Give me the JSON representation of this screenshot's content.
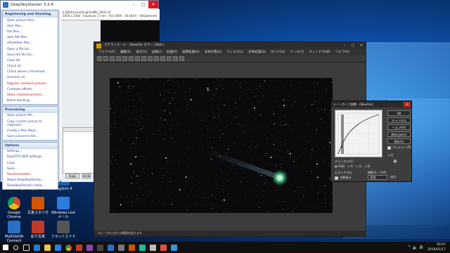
{
  "dss": {
    "title": "DeepSkyStacker 3.3.4",
    "infobar_line1": "E:\\DSS\\Comet\\Lights\\IMG_0001.tif",
    "infobar_line2": "3456 x 2304 - Exposure: 2 min - ISO 1600 - 16 bit/ch - (Registered)",
    "registering_panel": {
      "header": "Registering and Stacking",
      "items": [
        "Open picture files...",
        "dark files...",
        "flat files...",
        "dark flat files...",
        "offset/bias files...",
        "Open a file list...",
        "Save the file list...",
        "Clear list",
        "Check all",
        "Check above a threshold...",
        "Uncheck all",
        "Register checked pictures...",
        "Compute offsets...",
        "Stack checked pictures...",
        "Batch stacking..."
      ]
    },
    "processing_panel": {
      "header": "Processing",
      "items": [
        "Open picture file...",
        "Copy current picture to clipboard",
        "Create a Star Mask...",
        "Save picture to file..."
      ]
    },
    "options_panel": {
      "header": "Options",
      "items": [
        "Settings...",
        "Raw/FITS DDP Settings...",
        "Load...",
        "Save...",
        "Recommended...",
        "About DeepSkyStacker...",
        "DeepSkyStacker's Help..."
      ]
    },
    "apply_label": "Apply",
    "undo_label": "Undo"
  },
  "darkapp": {
    "title": "ステライメージ - [NewFile カラー 16bit]",
    "menu": [
      "ファイル(F)",
      "編集(E)",
      "表示(V)",
      "画像(I)",
      "処理(P)",
      "画像処理(A)",
      "天体写真(S)",
      "フィルタ(L)",
      "天体処理(D)",
      "ガイド(G)",
      "ツール(T)",
      "ウィンドウ(W)",
      "ヘルプ(H)"
    ],
    "status": "コピーされた全ての範囲を貼ります"
  },
  "tone": {
    "title": "トーンカーブ調整 - [NewFile]",
    "buttons": [
      "OK",
      "キャンセル",
      "ヘルプ(H)",
      "読み込み(L)",
      "保存(S)"
    ],
    "preview_label": "プレビュー(P)",
    "channel_label": "チャンネル(C)",
    "channels": [
      "RGB",
      "R",
      "G",
      "B"
    ],
    "histogram_label": "ヒストグラム",
    "log_label": "対数表示",
    "preset_label": "標準カーブ(P)",
    "preset_value": "直線",
    "input_label": "入力",
    "output_label": "出力"
  },
  "desktop_icons": [
    {
      "label": "GOS Utility",
      "color": "#2b6fc6"
    },
    {
      "label": "写真2006",
      "color": "#c0392b"
    },
    {
      "label": "RegSlim 4",
      "color": "#1f5fa8"
    },
    {
      "label": "Google Chrome",
      "color": "#e0a400"
    },
    {
      "label": "写真スタジオ",
      "color": "#d35400"
    },
    {
      "label": "Windows Live メール",
      "color": "#2a7de1"
    },
    {
      "label": "MyRSSION Connect",
      "color": "#2b6fc6"
    },
    {
      "label": "彩り写真",
      "color": "#c0392b"
    },
    {
      "label": "フラットエイド",
      "color": "#555555"
    }
  ],
  "taskbar": {
    "time": "20:47",
    "date": "2016/01/17",
    "tray": "^ 🔈 あ"
  }
}
